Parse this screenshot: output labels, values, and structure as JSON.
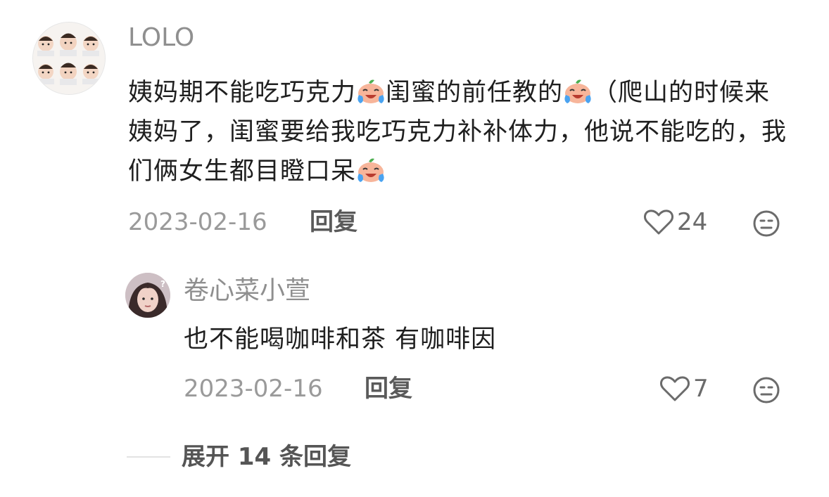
{
  "comment": {
    "username": "LOLO",
    "text_parts": [
      "姨妈期不能吃巧克力",
      "闺蜜的前任教的",
      "（爬山的时候来姨妈了，闺蜜要给我吃巧克力补补体力，他说不能吃的，我们俩女生都目瞪口呆"
    ],
    "emoji": "crying-laughing-emoji",
    "date": "2023-02-16",
    "reply_label": "回复",
    "like_count": "24"
  },
  "reply": {
    "username": "卷心菜小萱",
    "text": "也不能喝咖啡和茶 有咖啡因",
    "date": "2023-02-16",
    "reply_label": "回复",
    "like_count": "7"
  },
  "expand": {
    "label": "展开 14 条回复"
  },
  "colors": {
    "username": "#8f8f8f",
    "text": "#1f1f1f",
    "meta": "#9a9a9a"
  }
}
